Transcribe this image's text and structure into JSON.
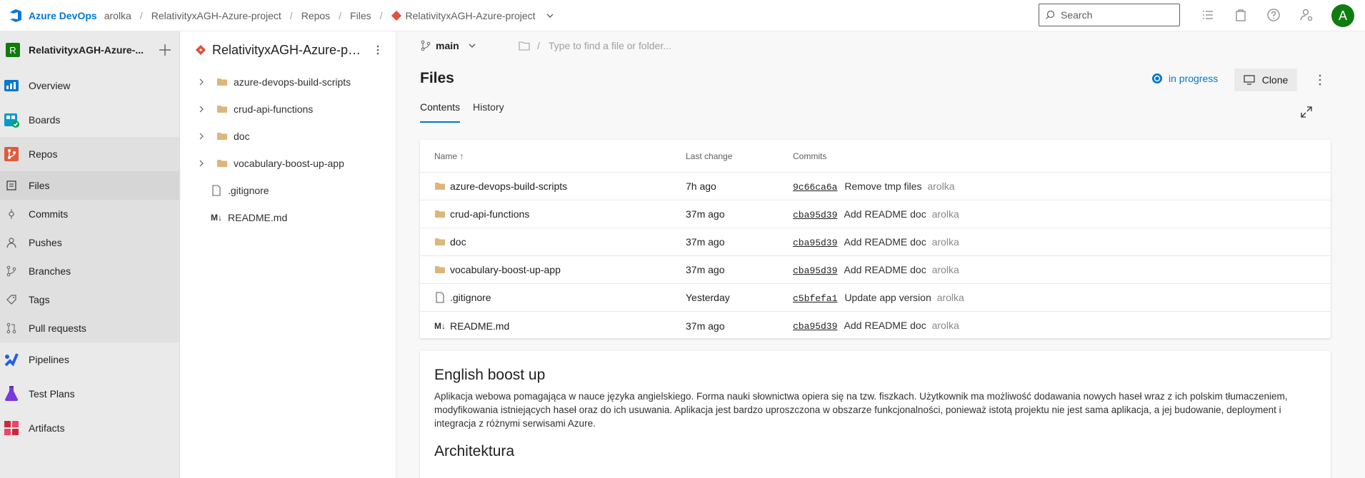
{
  "topbar": {
    "brand": "Azure DevOps",
    "org": "arolka",
    "project": "RelativityxAGH-Azure-project",
    "section": "Repos",
    "page": "Files",
    "repo": "RelativityxAGH-Azure-project",
    "search_placeholder": "Search",
    "avatar_initial": "A"
  },
  "leftnav": {
    "project_initial": "R",
    "project_name": "RelativityxAGH-Azure-...",
    "items": [
      {
        "label": "Overview",
        "icon": "overview-icon"
      },
      {
        "label": "Boards",
        "icon": "boards-icon"
      },
      {
        "label": "Repos",
        "icon": "repos-icon"
      }
    ],
    "repo_sub": [
      {
        "label": "Files"
      },
      {
        "label": "Commits"
      },
      {
        "label": "Pushes"
      },
      {
        "label": "Branches"
      },
      {
        "label": "Tags"
      },
      {
        "label": "Pull requests"
      }
    ],
    "bottom_items": [
      {
        "label": "Pipelines"
      },
      {
        "label": "Test Plans"
      },
      {
        "label": "Artifacts"
      }
    ]
  },
  "tree": {
    "repo_title": "RelativityxAGH-Azure-proj...",
    "items": [
      {
        "name": "azure-devops-build-scripts",
        "type": "folder"
      },
      {
        "name": "crud-api-functions",
        "type": "folder"
      },
      {
        "name": "doc",
        "type": "folder"
      },
      {
        "name": "vocabulary-boost-up-app",
        "type": "folder"
      },
      {
        "name": ".gitignore",
        "type": "file"
      },
      {
        "name": "README.md",
        "type": "markdown"
      }
    ]
  },
  "main": {
    "branch": "main",
    "path_placeholder": "Type to find a file or folder...",
    "title": "Files",
    "status": "in progress",
    "clone_label": "Clone",
    "tabs": [
      "Contents",
      "History"
    ],
    "columns": {
      "name": "Name",
      "sort": "↑",
      "last_change": "Last change",
      "commits": "Commits"
    },
    "rows": [
      {
        "name": "azure-devops-build-scripts",
        "type": "folder",
        "change": "7h ago",
        "hash": "9c66ca6a",
        "message": "Remove tmp files",
        "author": "arolka"
      },
      {
        "name": "crud-api-functions",
        "type": "folder",
        "change": "37m ago",
        "hash": "cba95d39",
        "message": "Add README doc",
        "author": "arolka"
      },
      {
        "name": "doc",
        "type": "folder",
        "change": "37m ago",
        "hash": "cba95d39",
        "message": "Add README doc",
        "author": "arolka"
      },
      {
        "name": "vocabulary-boost-up-app",
        "type": "folder",
        "change": "37m ago",
        "hash": "cba95d39",
        "message": "Add README doc",
        "author": "arolka"
      },
      {
        "name": ".gitignore",
        "type": "file",
        "change": "Yesterday",
        "hash": "c5bfefa1",
        "message": "Update app version",
        "author": "arolka"
      },
      {
        "name": "README.md",
        "type": "markdown",
        "change": "37m ago",
        "hash": "cba95d39",
        "message": "Add README doc",
        "author": "arolka"
      }
    ]
  },
  "readme": {
    "heading": "English boost up",
    "paragraph": "Aplikacja webowa pomagająca w nauce języka angielskiego. Forma nauki słownictwa opiera się na tzw. fiszkach. Użytkownik ma możliwość dodawania nowych haseł wraz z ich polskim tłumaczeniem, modyfikowania istniejących haseł oraz do ich usuwania. Aplikacja jest bardzo uproszczona w obszarze funkcjonalności, ponieważ istotą projektu nie jest sama aplikacja, a jej budowanie, deployment i integracja z różnymi serwisami Azure.",
    "subheading": "Architektura"
  },
  "colors": {
    "accent": "#0078d4",
    "project_badge": "#107c10"
  }
}
